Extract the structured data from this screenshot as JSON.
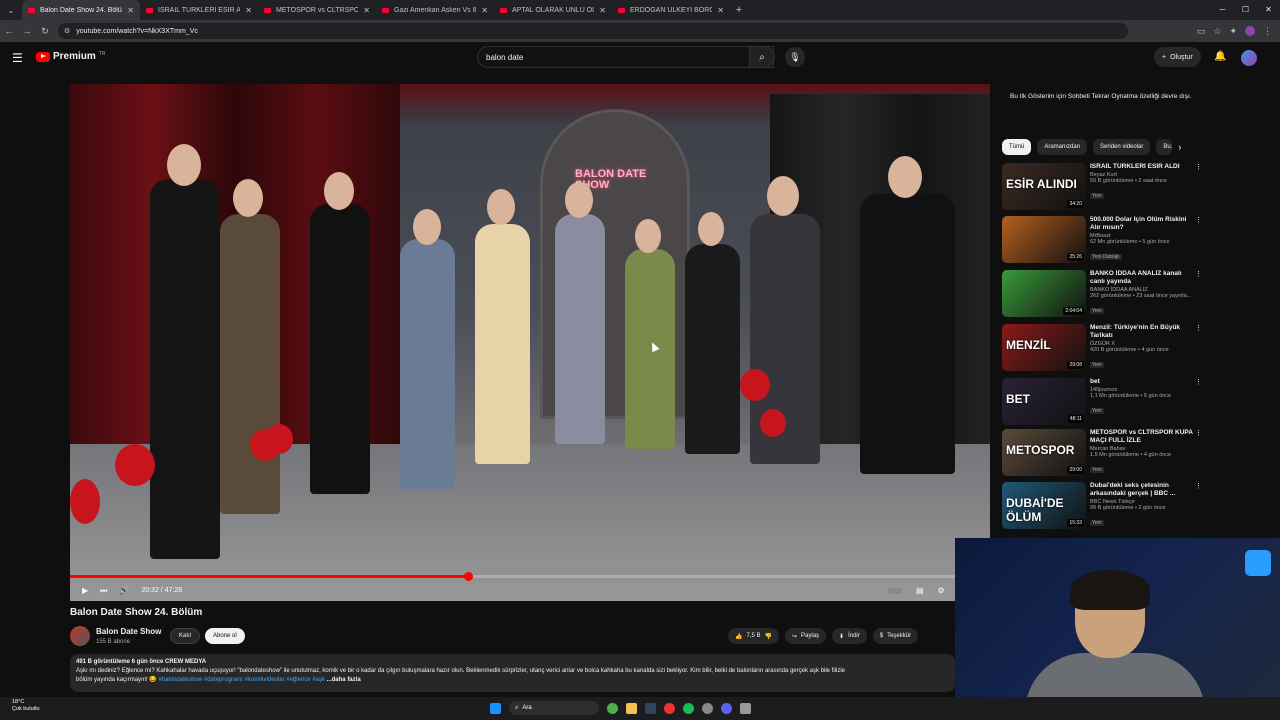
{
  "browser": {
    "tabs": [
      {
        "title": "Balon Date Show 24. Bölüm - YouTube",
        "active": true
      },
      {
        "title": "İSRAİL TÜRKLERİ ESİR ALDI - YouTube",
        "active": false
      },
      {
        "title": "METOSPOR vs CLTRSPOR KUPA",
        "active": false
      },
      {
        "title": "Gazi Amerikan Askeri Vs 8 Polis",
        "active": false
      },
      {
        "title": "APTAL OLARAK ÜNLÜ OLMAK",
        "active": false
      },
      {
        "title": "ERDOĞAN ÜLKEYİ BORCA SOKTU",
        "active": false
      }
    ],
    "url": "youtube.com/watch?v=NkX3XTmm_Vc"
  },
  "youtube": {
    "brand": "Premium",
    "brand_sup": "TR",
    "search_value": "balon date",
    "create_label": "Oluştur"
  },
  "video": {
    "time": "20:32 / 47:28",
    "progress_fraction": 0.4327,
    "neon_sign": "BALON DATE SHOW",
    "title": "Balon Date Show 24. Bölüm",
    "channel": "Balon Date Show",
    "subscribers": "155 B abone",
    "join_label": "Katıl",
    "subscribe_label": "Abone ol",
    "likes": "7,5 B",
    "share_label": "Paylaş",
    "download_label": "İndir",
    "thanks_label": "Teşekkür",
    "desc_meta": "491 B görüntüleme  6 gün önce  CREW MEDYA",
    "desc_line1": "Aşkı mı dediniz? Eğlence mi? Kahkahalar havada uçuşuyor! \"balondateshow\" ile unutulmaz, komik ve bir o kadar da çılgın buluşmalara hazır olun. Beklenmedik sürprizler, utanç verici anlar ve bolca kahkaha bu kanalda sizi bekliyor. Kim bilir, belki de balonların arasında gerçek aşk bile filizle",
    "desc_line2": "bölüm yayında kaçırmayın! 😀",
    "desc_tags": "#balondateshow #dateprogramı #komikvideolar #eğlence #aşk",
    "desc_more": "...daha fazla"
  },
  "sidebar": {
    "notice": "Bu Ilk Gösterim için Sohbeti Tekrar Oynatma özelliği devre dışı.",
    "chips": [
      "Tümü",
      "Aramanızdan",
      "Seriden videolar",
      "Bu..."
    ],
    "recommendations": [
      {
        "title": "İSRAİL TÜRKLERİ ESİR ALDI",
        "channel": "Beyaz Kurt",
        "views": "59 B görüntüleme • 2 saat önce",
        "badge": "Yeni",
        "duration": "34:20",
        "thumb_text": "ESİR ALINDI",
        "color": "#3b2a22"
      },
      {
        "title": "500.000 Dolar İçin Ölüm Riskini Alır mısın?",
        "channel": "MrBeast",
        "views": "62 Mn görüntüleme • 5 gün önce",
        "badge": "Yeni  Dublajlı",
        "duration": "25:26",
        "thumb_text": "",
        "color": "#b5601f"
      },
      {
        "title": "BANKO İDDAA ANALİZ kanalı canlı yayında",
        "channel": "BANKO İDDAA ANALİZ",
        "views": "262 görüntüleme • 23 saat önce yayınla...",
        "badge": "Yeni",
        "duration": "2:04:04",
        "thumb_text": "",
        "color": "#3a9a3a"
      },
      {
        "title": "Menzil: Türkiye'nin En Büyük Tarikatı",
        "channel": "ÖZGÜR X",
        "views": "420 B görüntüleme • 4 gün önce",
        "badge": "Yeni",
        "duration": "29:08",
        "thumb_text": "MENZİL",
        "color": "#8a1a1a"
      },
      {
        "title": "bet",
        "channel": "140journos",
        "views": "1,1 Mn görüntüleme • 6 gün önce",
        "badge": "Yeni",
        "duration": "48:11",
        "thumb_text": "BET",
        "color": "#2a2238"
      },
      {
        "title": "METOSPOR vs CLTRSPOR KUPA MAÇI FULL İZLE",
        "channel": "Mercan Bahav",
        "views": "1,5 Mn görüntüleme • 4 gün önce",
        "badge": "Yeni",
        "duration": "29:00",
        "thumb_text": "METOSPOR",
        "color": "#5a4a3a"
      },
      {
        "title": "Dubai'deki seks çetesinin arkasındaki gerçek | BBC ...",
        "channel": "BBC News Türkçe",
        "views": "99 B görüntüleme • 2 gün önce",
        "badge": "Yeni",
        "duration": "15:33",
        "thumb_text": "DUBAİ'DE ÖLÜM",
        "color": "#1e5a7a"
      }
    ]
  },
  "taskbar": {
    "weather_temp": "18°C",
    "weather_desc": "Çok bulutlu",
    "search_label": "Ara"
  }
}
